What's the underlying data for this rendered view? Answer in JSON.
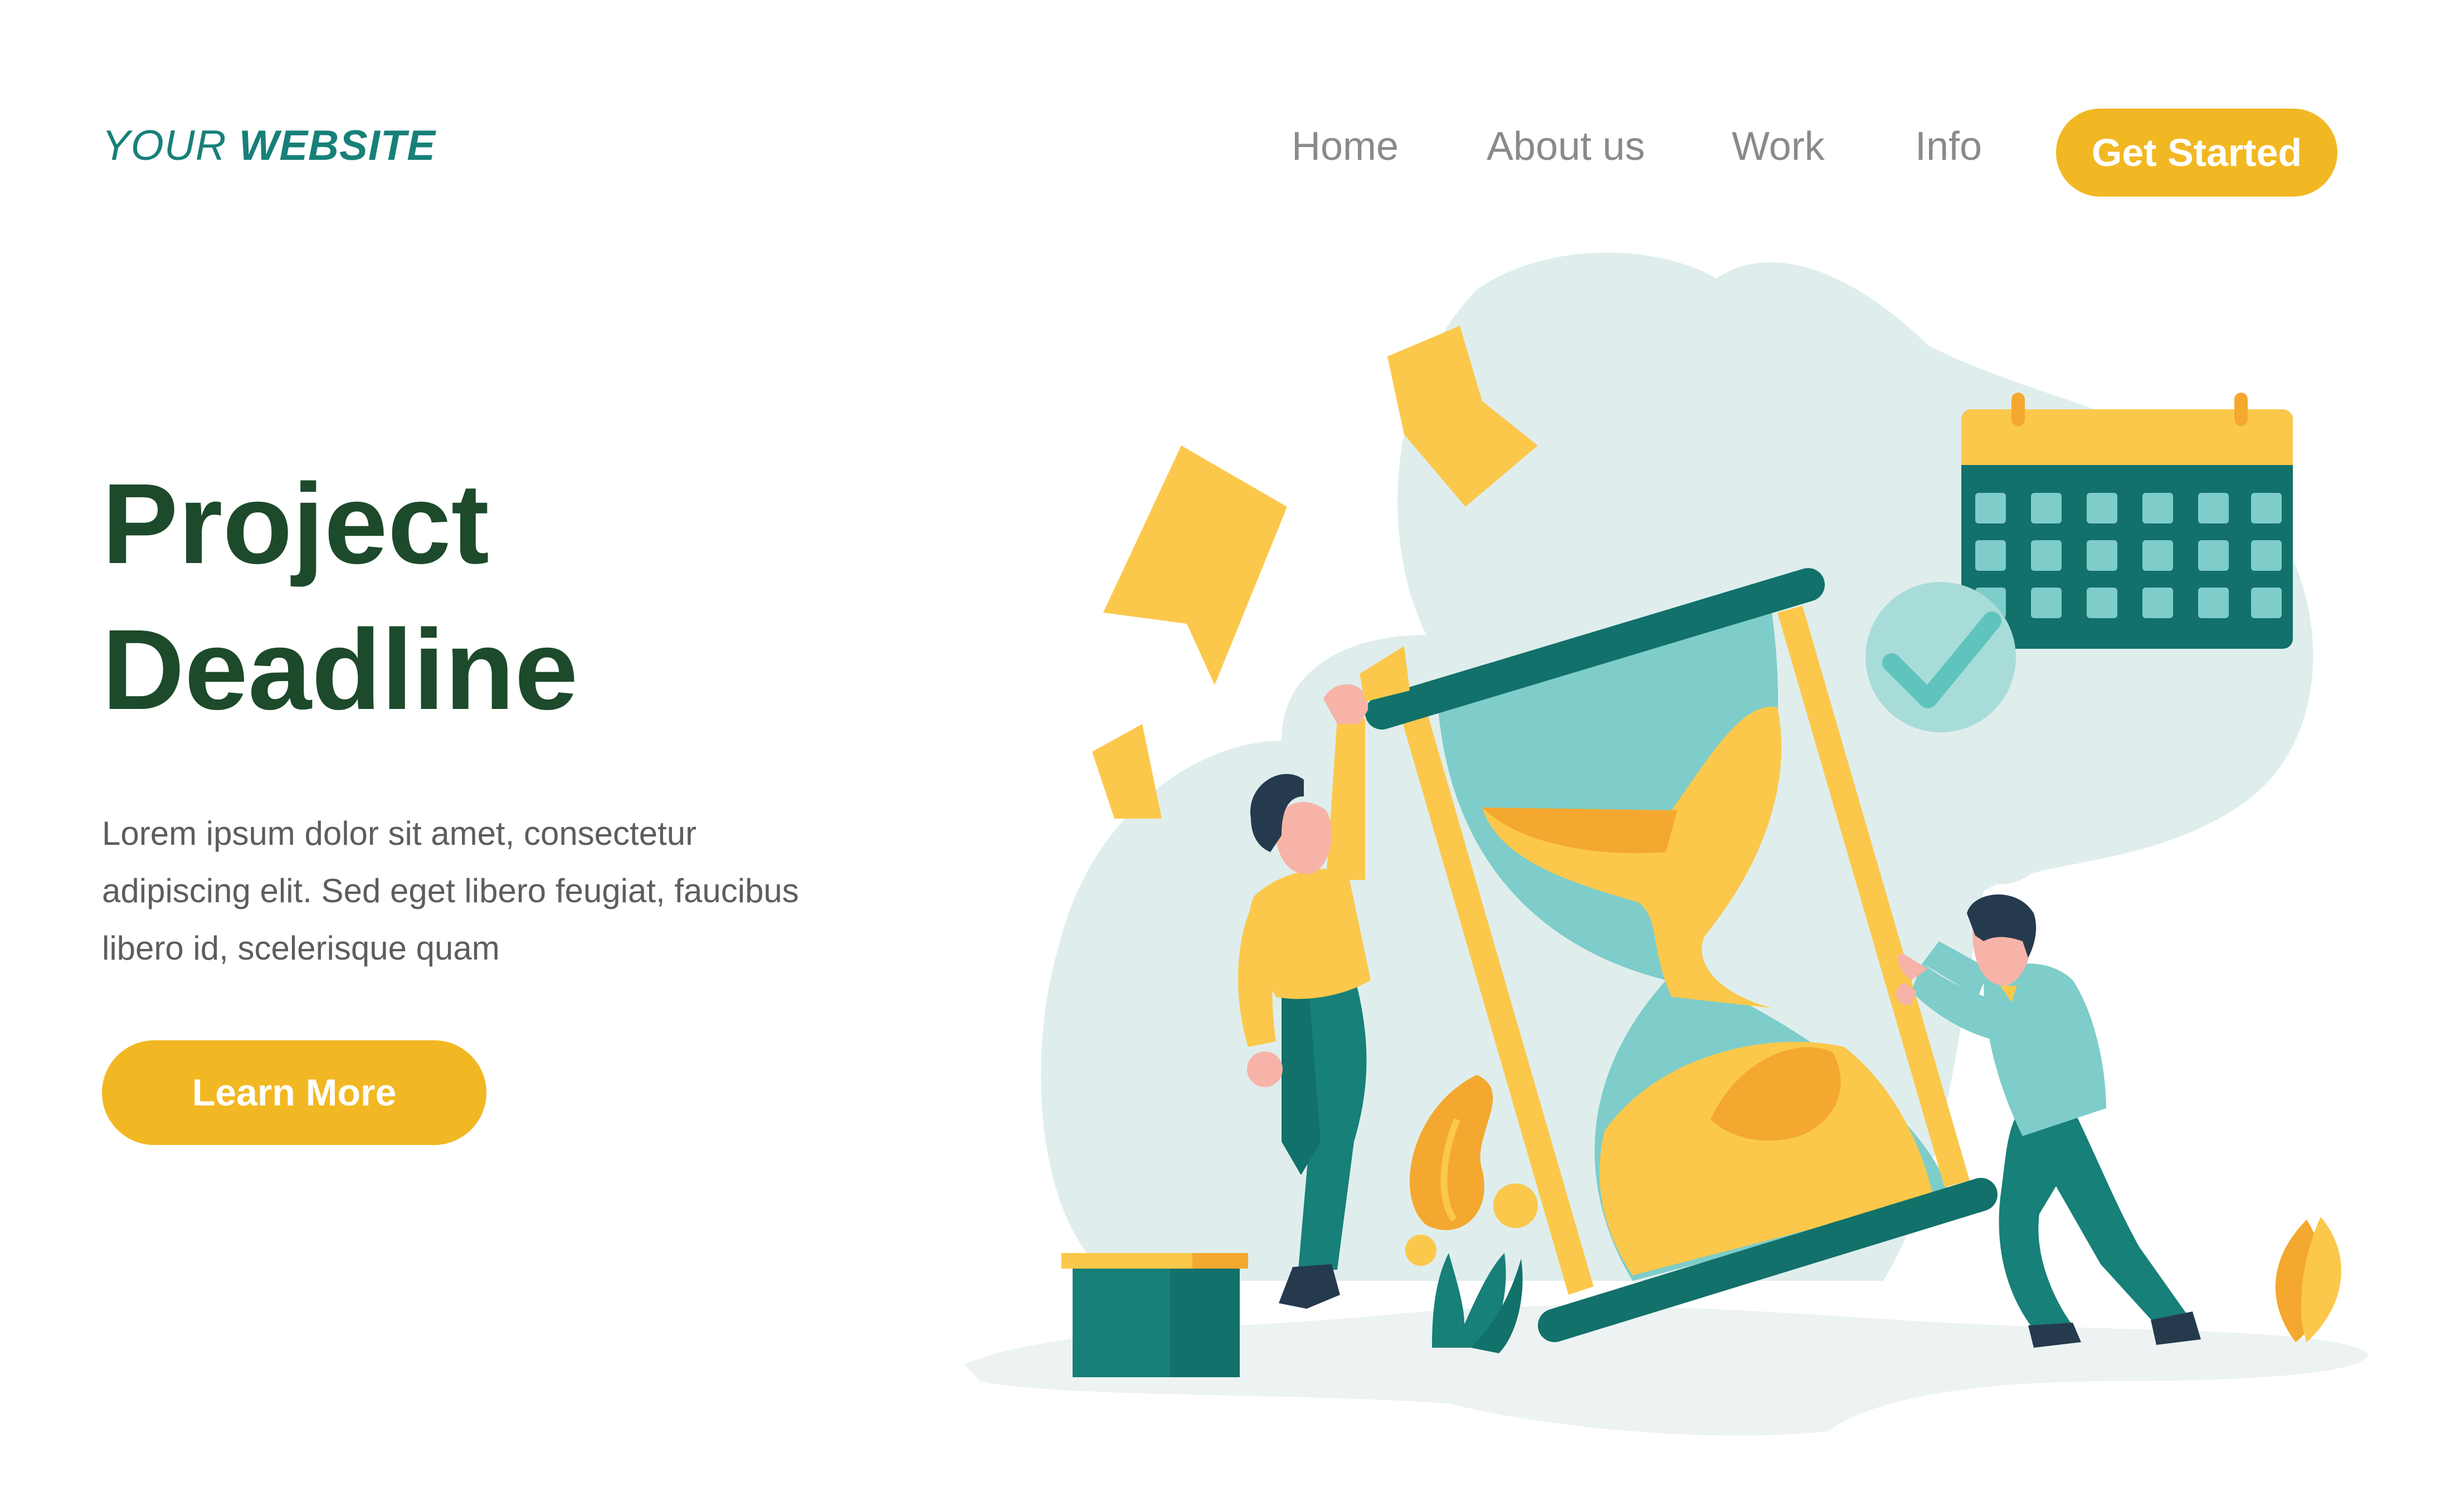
{
  "header": {
    "logo_light": "YOUR",
    "logo_bold": "WEBSITE",
    "nav": [
      "Home",
      "About us",
      "Work",
      "Info"
    ],
    "cta_label": "Get Started"
  },
  "hero": {
    "title_line1": "Project",
    "title_line2": "Deadline",
    "description": "Lorem ipsum dolor sit amet, consectetur adipiscing elit. Sed eget libero feugiat, faucibus libero id, scelerisque quam",
    "button_label": "Learn More"
  },
  "colors": {
    "brand": "#178078",
    "accent": "#f2b823",
    "title": "#1c4a2b",
    "teal_dark": "#12716a",
    "teal_light": "#7ecdca",
    "blob": "#dfeeed"
  }
}
